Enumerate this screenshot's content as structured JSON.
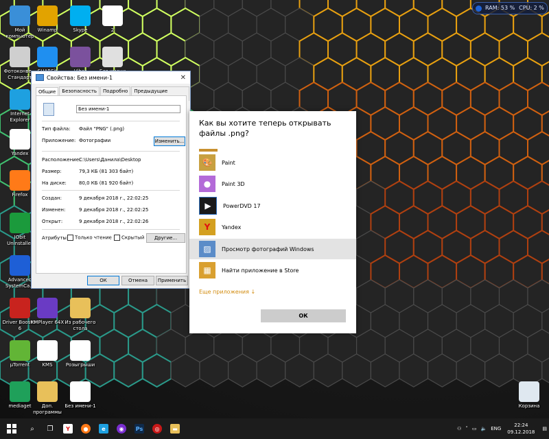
{
  "system_meter": {
    "ram": "RAM: 53 %",
    "cpu": "CPU: 2 %"
  },
  "desktop_icons": [
    {
      "label": "Мой компьютер",
      "icon": "computer-icon",
      "color": "#3a8fd8"
    },
    {
      "label": "Winamp",
      "icon": "winamp-icon",
      "color": "#e2a300"
    },
    {
      "label": "Skype",
      "icon": "skype-icon",
      "color": "#00aff0"
    },
    {
      "label": "2",
      "icon": "file-icon",
      "color": "#ffffff"
    },
    {
      "label": "Фотоконве... Стандарт",
      "icon": "printer-icon",
      "color": "#cfcfcf"
    },
    {
      "label": "SHAREit",
      "icon": "shareit-icon",
      "color": "#1f8ff0"
    },
    {
      "label": "Viber",
      "icon": "viber-icon",
      "color": "#7b519d"
    },
    {
      "label": "Без имени",
      "icon": "image-file-icon",
      "color": "#e0e0e0"
    },
    {
      "label": "Internet Explorer",
      "icon": "ie-icon",
      "color": "#1ea0e0"
    },
    {
      "label": "Yandex",
      "icon": "yandex-icon",
      "color": "#ffffff"
    },
    {
      "label": "Firefox",
      "icon": "firefox-icon",
      "color": "#ff7a18"
    },
    {
      "label": "IObit Uninstaller",
      "icon": "iobit-icon",
      "color": "#1b9a3c"
    },
    {
      "label": "Advanced SystemCa...",
      "icon": "advanced-systemcare-icon",
      "color": "#1e5fd6"
    },
    {
      "label": "Driver Booster 6",
      "icon": "driver-booster-icon",
      "color": "#c8231e"
    },
    {
      "label": "KMPlayer 64X",
      "icon": "kmplayer-icon",
      "color": "#6a3bc4"
    },
    {
      "label": "Из рабочего стола",
      "icon": "folder-icon",
      "color": "#e8c05a"
    },
    {
      "label": "µTorrent",
      "icon": "utorrent-icon",
      "color": "#62b536"
    },
    {
      "label": "KMS",
      "icon": "kms-icon",
      "color": "#ffffff"
    },
    {
      "label": "Розыгрыши",
      "icon": "document-icon",
      "color": "#ffffff"
    },
    {
      "label": "mediaget",
      "icon": "mediaget-icon",
      "color": "#1fa05a"
    },
    {
      "label": "Доп. программы",
      "icon": "folder-icon",
      "color": "#e8c05a"
    },
    {
      "label": "Без имени-1",
      "icon": "document-icon",
      "color": "#ffffff"
    },
    {
      "label": "Корзина",
      "icon": "recycle-bin-icon",
      "color": "#dfe8f0"
    }
  ],
  "properties_dialog": {
    "title": "Свойства: Без имени-1",
    "tabs": [
      "Общие",
      "Безопасность",
      "Подробно",
      "Предыдущие версии"
    ],
    "file_name": "Без имени-1",
    "file_type_label": "Тип файла:",
    "file_type_value": "Файл \"PNG\" (.png)",
    "app_label": "Приложение:",
    "app_value": "Фотографии",
    "change_button": "Изменить...",
    "location_label": "Расположение:",
    "location_value": "C:\\Users\\Данила\\Desktop",
    "size_label": "Размер:",
    "size_value": "79,3 КБ (81 303 байт)",
    "disk_label": "На диске:",
    "disk_value": "80,0 КБ (81 920 байт)",
    "created_label": "Создан:",
    "created_value": "9 декабря 2018 г., 22:02:25",
    "modified_label": "Изменен:",
    "modified_value": "9 декабря 2018 г., 22:02:25",
    "opened_label": "Открыт:",
    "opened_value": "9 декабря 2018 г., 22:02:26",
    "attributes_label": "Атрибуты:",
    "readonly_label": "Только чтение",
    "hidden_label": "Скрытый",
    "other_button": "Другие...",
    "ok_button": "ОК",
    "cancel_button": "Отмена",
    "apply_button": "Применить"
  },
  "open_with": {
    "heading": "Как вы хотите теперь открывать файлы .png?",
    "apps": [
      {
        "name": "Paint",
        "icon": "paint-icon",
        "color": "#c8a040"
      },
      {
        "name": "Paint 3D",
        "icon": "paint-3d-icon",
        "color": "#b36ad8"
      },
      {
        "name": "PowerDVD 17",
        "icon": "powerdvd-icon",
        "color": "#1a1a1a"
      },
      {
        "name": "Yandex",
        "icon": "yandex-icon",
        "color": "#d4a020"
      },
      {
        "name": "Просмотр фотографий Windows",
        "icon": "photo-viewer-icon",
        "color": "#5b8cc8"
      },
      {
        "name": "Найти приложение в Store",
        "icon": "store-icon",
        "color": "#d9a030"
      }
    ],
    "more_apps": "Еще приложения ↓",
    "ok_button": "ОК"
  },
  "taskbar": {
    "language": "ENG",
    "time": "22:24",
    "date": "09.12.2018"
  }
}
